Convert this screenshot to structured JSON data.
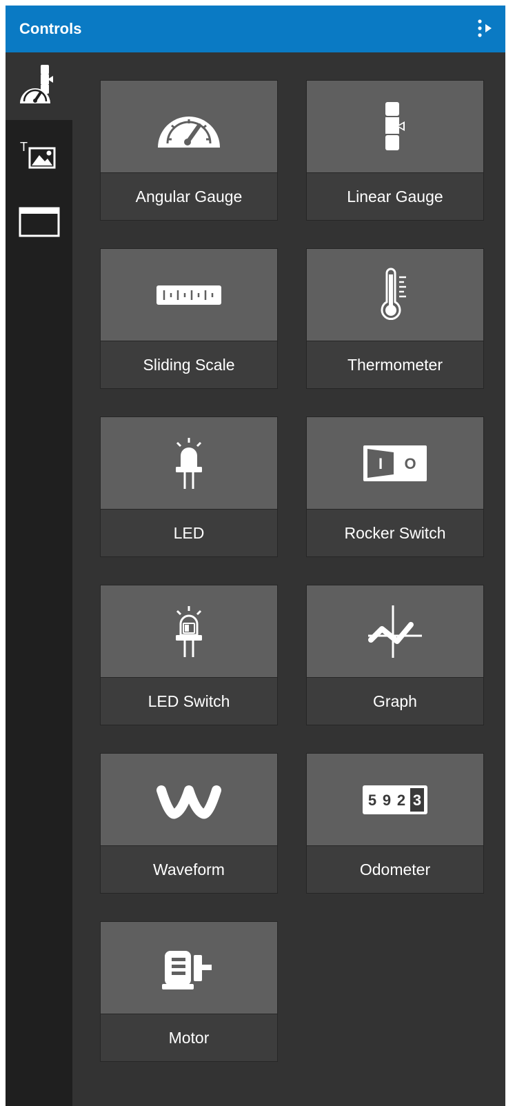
{
  "header": {
    "title": "Controls",
    "menu_icon": "more-vertical-arrow-icon"
  },
  "sidebar": {
    "items": [
      {
        "name": "controls-category",
        "icon": "gauge-slider-icon",
        "active": true
      },
      {
        "name": "text-image-category",
        "icon": "text-image-icon",
        "active": false
      },
      {
        "name": "window-category",
        "icon": "window-icon",
        "active": false
      }
    ]
  },
  "controls": [
    {
      "label": "Angular Gauge",
      "icon": "angular-gauge-icon"
    },
    {
      "label": "Linear Gauge",
      "icon": "linear-gauge-icon"
    },
    {
      "label": "Sliding Scale",
      "icon": "sliding-scale-icon"
    },
    {
      "label": "Thermometer",
      "icon": "thermometer-icon"
    },
    {
      "label": "LED",
      "icon": "led-icon"
    },
    {
      "label": "Rocker Switch",
      "icon": "rocker-switch-icon",
      "glyphs": [
        "I",
        "O"
      ]
    },
    {
      "label": "LED Switch",
      "icon": "led-switch-icon"
    },
    {
      "label": "Graph",
      "icon": "graph-icon"
    },
    {
      "label": "Waveform",
      "icon": "waveform-icon"
    },
    {
      "label": "Odometer",
      "icon": "odometer-icon",
      "digits": "5923"
    },
    {
      "label": "Motor",
      "icon": "motor-icon"
    }
  ],
  "colors": {
    "header": "#0a7ac4",
    "panel": "#333333",
    "sidebar": "#1f1f1f",
    "tile_top": "#5f5f5f",
    "tile_bottom": "#3d3d3d"
  }
}
